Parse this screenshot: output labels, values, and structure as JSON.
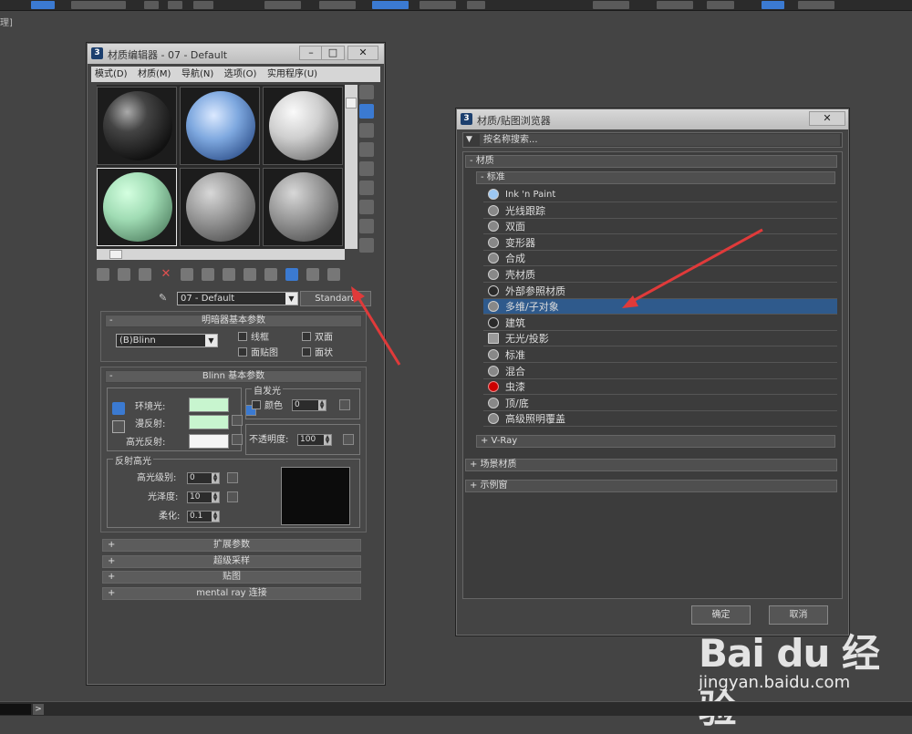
{
  "viewport_label": "理]",
  "material_editor": {
    "title": "材质编辑器 - 07 - Default",
    "menu": [
      "模式(D)",
      "材质(M)",
      "导航(N)",
      "选项(O)",
      "实用程序(U)"
    ],
    "material_name": "07 - Default",
    "type_button": "Standard",
    "shader_panel": {
      "title": "明暗器基本参数",
      "shader": "(B)Blinn",
      "checks": [
        "线框",
        "双面",
        "面贴图",
        "面状"
      ]
    },
    "blinn_panel": {
      "title": "Blinn 基本参数",
      "ambient_label": "环境光:",
      "diffuse_label": "漫反射:",
      "specular_label": "高光反射:",
      "self_illum_title": "自发光",
      "color_label": "颜色",
      "color_value": "0",
      "opacity_label": "不透明度:",
      "opacity_value": "100",
      "spec_title": "反射高光",
      "spec_level_label": "高光级别:",
      "spec_level_value": "0",
      "gloss_label": "光泽度:",
      "gloss_value": "10",
      "soften_label": "柔化:",
      "soften_value": "0.1"
    },
    "rollouts": [
      "扩展参数",
      "超级采样",
      "贴图",
      "mental ray 连接"
    ]
  },
  "browser": {
    "title": "材质/贴图浏览器",
    "search_placeholder": "按名称搜索...",
    "category_materials": "- 材质",
    "category_standard": "- 标准",
    "items": [
      "Ink 'n Paint",
      "光线跟踪",
      "双面",
      "变形器",
      "合成",
      "壳材质",
      "外部参照材质",
      "多维/子对象",
      "建筑",
      "无光/投影",
      "标准",
      "混合",
      "虫漆",
      "顶/底",
      "高级照明覆盖"
    ],
    "selected_index": 7,
    "vray": "+ V-Ray",
    "scene_materials": "+ 场景材质",
    "sample_slots": "+ 示例窗",
    "ok": "确定",
    "cancel": "取消"
  },
  "watermark": {
    "logo": "Bai du 经验",
    "url": "jingyan.baidu.com"
  },
  "colors": {
    "ambient": "#c8f5cf",
    "diffuse": "#c8f5cf",
    "specular": "#f4f4f4",
    "selection": "#2f5a8c",
    "arrow": "#e03a3a"
  }
}
